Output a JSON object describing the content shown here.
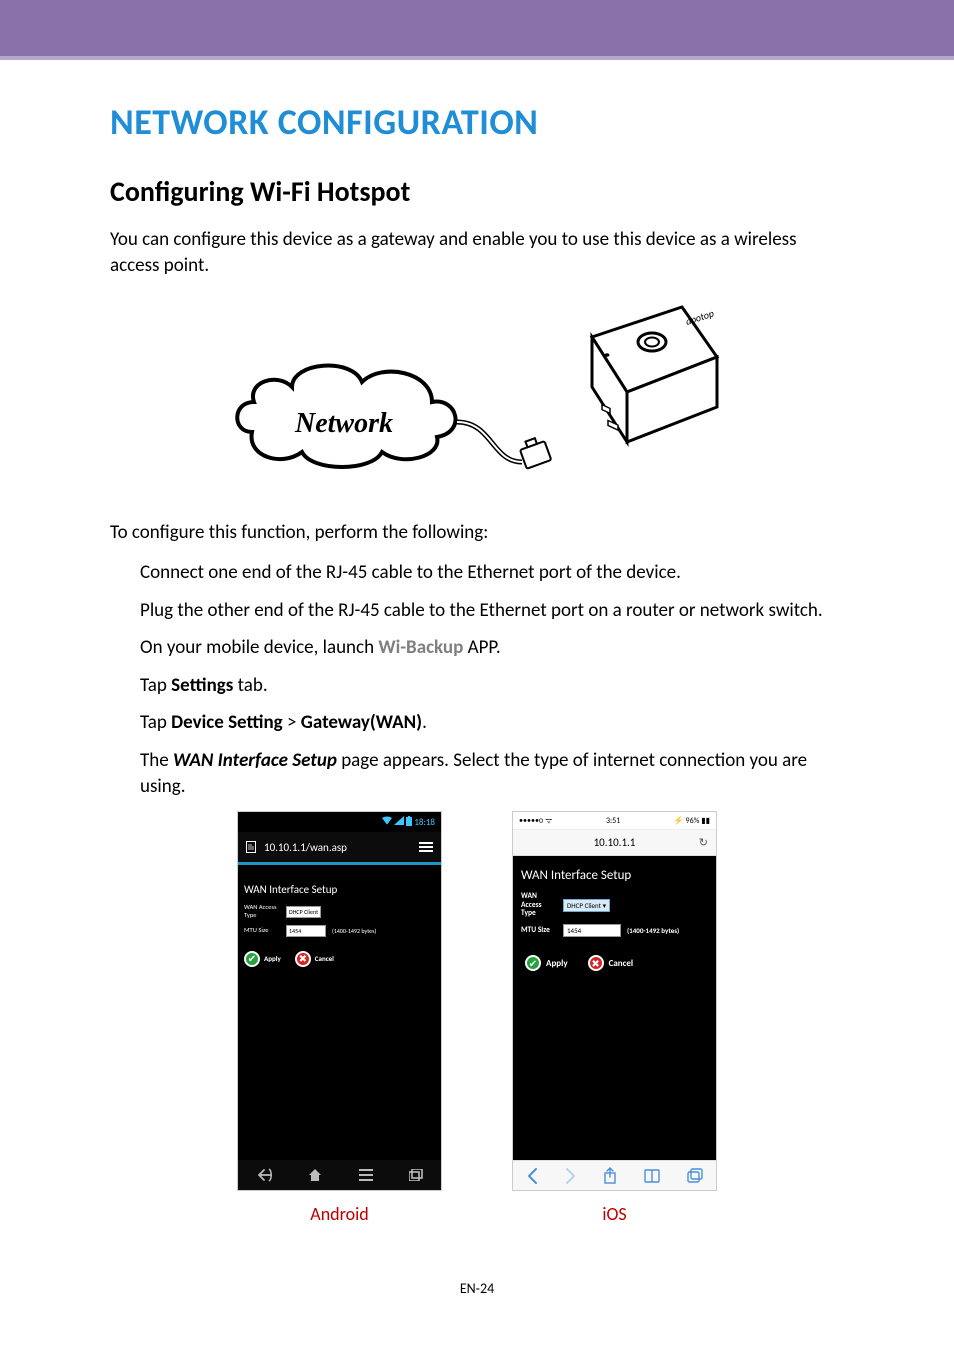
{
  "heading": "NETWORK CONFIGURATION",
  "subheading": "Configuring Wi-Fi Hotspot",
  "intro": "You can configure this device as a gateway and enable you to use this device as a wireless access point.",
  "figure": {
    "cloud_label": "Network"
  },
  "lead": "To configure this function, perform the following:",
  "steps": {
    "s1": "Connect one end of the RJ-45 cable to the Ethernet port of the device.",
    "s2": "Plug the other end of the RJ-45 cable to the Ethernet port on a router or network switch.",
    "s3a": "On your mobile device, launch ",
    "s3_app": "Wi-Backup",
    "s3b": " APP.",
    "s4a": "Tap ",
    "s4_bold": "Settings",
    "s4b": " tab.",
    "s5a": "Tap ",
    "s5_b1": "Device Setting",
    "s5_mid": " > ",
    "s5_b2": "Gateway(WAN)",
    "s5b": ".",
    "s6a": "The ",
    "s6_bi": "WAN Interface Setup",
    "s6b": " page appears. Select the type of internet connection you are using."
  },
  "android": {
    "status_time": "18:18",
    "url": "10.10.1.1/wan.asp",
    "section_title": "WAN Interface Setup",
    "label_access": "WAN Access Type",
    "select_access": "DHCP Client",
    "label_mtu": "MTU Size",
    "input_mtu": "1454",
    "hint_mtu": "(1400-1492 bytes)",
    "btn_apply": "Apply",
    "btn_cancel": "Cancel",
    "caption": "Android"
  },
  "ios": {
    "status_left": "•••••○ ᯤ",
    "status_center": "3:51",
    "status_right": "⚡ 96% ▮▮",
    "url": "10.10.1.1",
    "refresh": "↻",
    "section_title": "WAN Interface Setup",
    "label_access": "WAN Access Type",
    "select_access": "DHCP Client ▾",
    "label_mtu": "MTU Size",
    "input_mtu": "1454",
    "hint_mtu": "(1400-1492 bytes)",
    "btn_apply": "Apply",
    "btn_cancel": "Cancel",
    "caption": "iOS"
  },
  "page_number": "EN-24"
}
